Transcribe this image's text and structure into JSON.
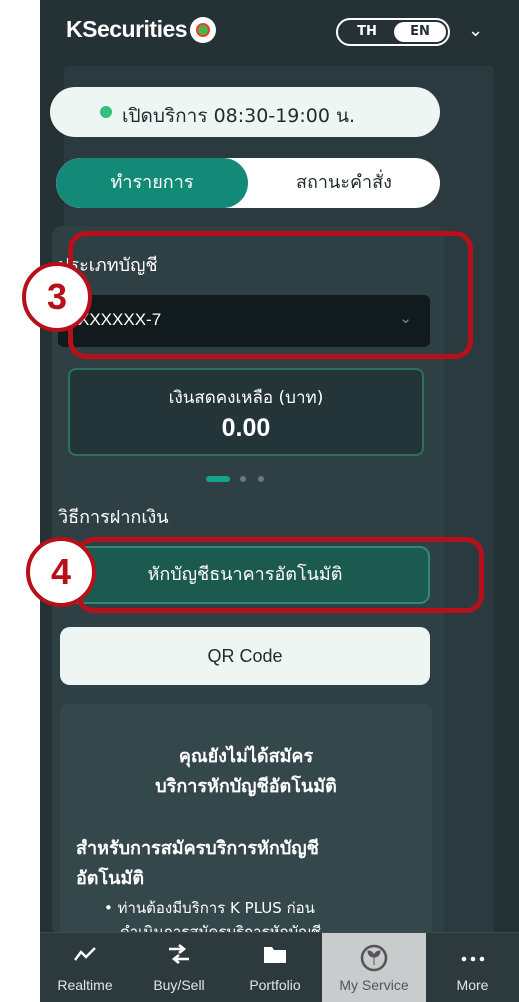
{
  "header": {
    "logo_text": "KSecurities",
    "lang_th": "TH",
    "lang_en": "EN",
    "lang_active": "EN"
  },
  "status": {
    "text": "เปิดบริการ 08:30-19:00 น.",
    "dot_color": "#34c07a"
  },
  "tabs": [
    {
      "label": "ทำรายการ",
      "active": true
    },
    {
      "label": "สถานะคำสั่ง",
      "active": false
    }
  ],
  "account": {
    "label": "ประเภทบัญชี",
    "selected": "XXXXXX-7"
  },
  "balance": {
    "label": "เงินสดคงเหลือ (บาท)",
    "value": "0.00"
  },
  "pager": {
    "count": 3,
    "active": 1
  },
  "deposit": {
    "label": "วิธีการฝากเงิน",
    "auto_debit_label": "หักบัญชีธนาคารอัตโนมัติ",
    "qr_label": "QR Code"
  },
  "info": {
    "title_line1": "คุณยังไม่ได้สมัคร",
    "title_line2": "บริการหักบัญชีอัตโนมัติ",
    "subtitle_line1": "สำหรับการสมัครบริการหักบัญชี",
    "subtitle_line2": "อัตโนมัติ",
    "bullet_line1": "• ท่านต้องมีบริการ K PLUS ก่อน",
    "bullet_line2": "ดำเนินการสมัครบริการหักบัญชี"
  },
  "nav": [
    {
      "label": "Realtime",
      "icon": "chart-line-icon",
      "active": false
    },
    {
      "label": "Buy/Sell",
      "icon": "buy-sell-arrows-icon",
      "active": false
    },
    {
      "label": "Portfolio",
      "icon": "folder-icon",
      "active": false
    },
    {
      "label": "My Service",
      "icon": "leaf-service-icon",
      "active": true
    },
    {
      "label": "More",
      "icon": "more-dots-icon",
      "active": false
    }
  ],
  "annotations": [
    {
      "number": "3"
    },
    {
      "number": "4"
    }
  ],
  "colors": {
    "brand_green": "#138a78",
    "callout_red": "#b8101a",
    "background_dark": "#243236"
  }
}
